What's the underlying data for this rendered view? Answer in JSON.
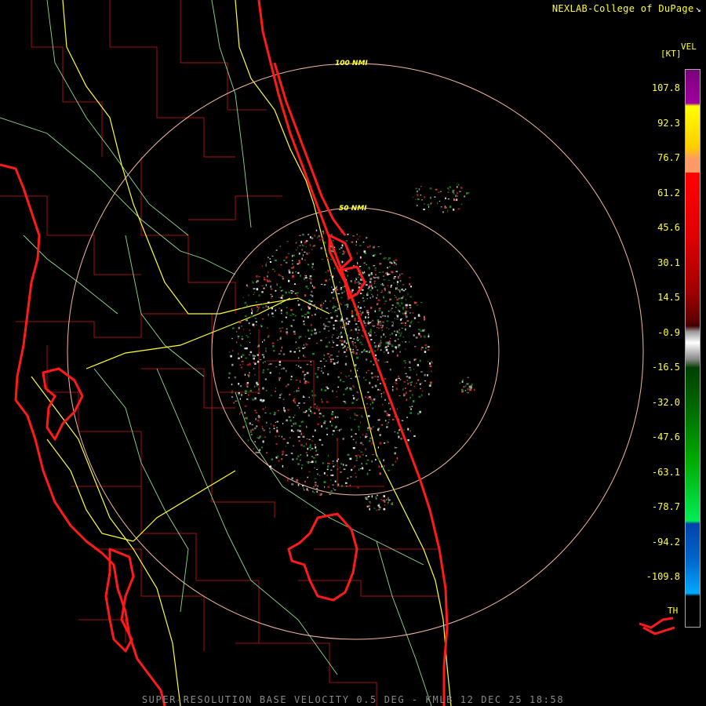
{
  "header": {
    "credit": "NEXLAB-College of DuPage",
    "credit_icon": "cursor-icon"
  },
  "map": {
    "region": "East-central Florida",
    "radar_site": "KMLB",
    "range_rings": [
      {
        "label": "100 NMI",
        "nmi": 100
      },
      {
        "label": "50 NMI",
        "nmi": 50
      }
    ],
    "colors": {
      "background": "#000000",
      "county_lines": "#b01010",
      "coastline": "#ff1a1a",
      "highways": "#ffff33",
      "roads": "#90ee90",
      "range_rings": "#f4b8a0"
    }
  },
  "legend": {
    "product": "VEL",
    "units": "[KT]",
    "ticks": [
      "107.8",
      "92.3",
      "76.7",
      "61.2",
      "45.6",
      "30.1",
      "14.5",
      "-0.9",
      "-16.5",
      "-32.0",
      "-47.6",
      "-63.1",
      "-78.7",
      "-94.2",
      "-109.8"
    ],
    "th_label": "TH"
  },
  "footer": {
    "caption": "SUPER-RESOLUTION BASE VELOCITY 0.5 DEG - KMLB 12 DEC 25 18:58"
  }
}
